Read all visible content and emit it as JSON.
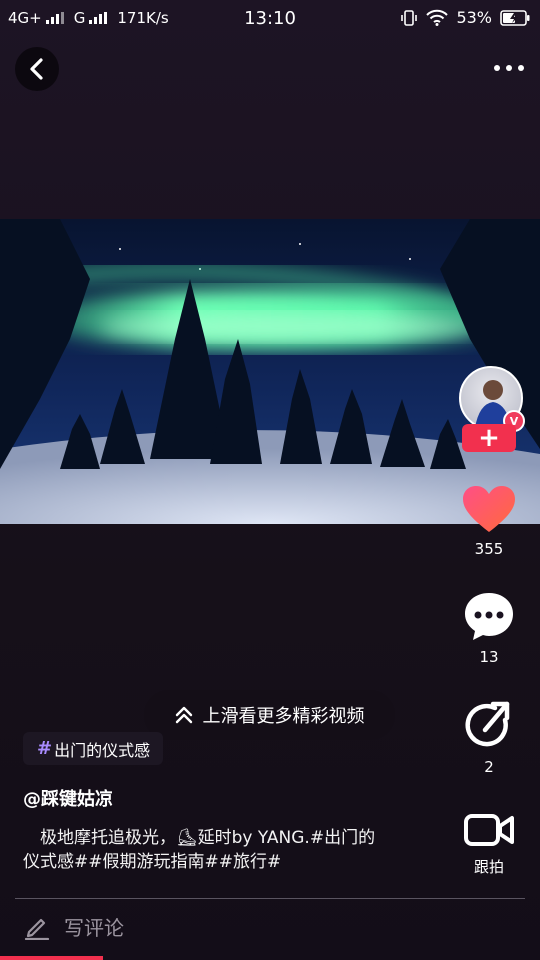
{
  "status_bar": {
    "network1": "4G+",
    "network2": "G",
    "speed": "171K/s",
    "time": "13:10",
    "battery": "53%"
  },
  "nav": {
    "back_icon": "chevron-left-icon",
    "more_icon": "more-dots-icon"
  },
  "rail": {
    "follow_label": "+",
    "verified_label": "V",
    "likes": "355",
    "comments": "13",
    "shares": "2",
    "duet_label": "跟拍"
  },
  "overlay": {
    "swipe_hint": "上滑看更多精彩视频",
    "hashtag_symbol": "#",
    "hashtag_label": "出门的仪式感",
    "author": "@踩键姑凉",
    "description_line1": "　极地摩托追极光，⛸延时by YANG.#出门的",
    "description_line2": "仪式感##假期游玩指南##旅行#"
  },
  "comment_bar": {
    "placeholder": "写评论"
  },
  "colors": {
    "accent": "#f2304e",
    "aurora": "#5dffb0",
    "hashtag": "#a98cff",
    "background": "#1a1220"
  },
  "playback_progress": 0.19
}
